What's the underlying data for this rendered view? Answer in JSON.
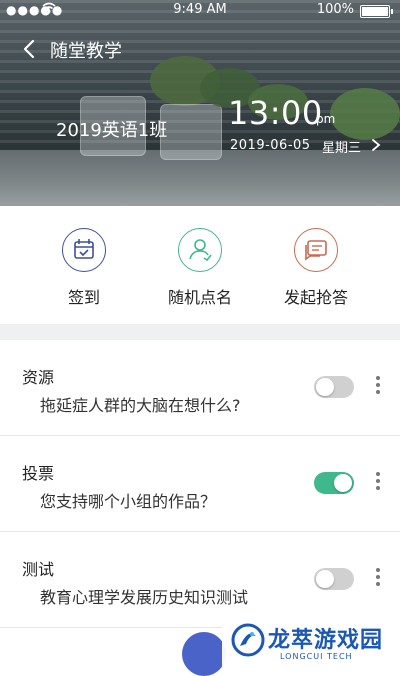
{
  "status": {
    "signal": "●●●●●",
    "time": "9:49 AM",
    "battery": "100%"
  },
  "nav": {
    "title": "随堂教学"
  },
  "hero": {
    "class_name": "2019英语1班",
    "clock": "13:00",
    "ampm": "pm",
    "date": "2019-06-05",
    "weekday": "星期三"
  },
  "actions": [
    {
      "label": "签到",
      "color": "#3e4fa0"
    },
    {
      "label": "随机点名",
      "color": "#3fb88e"
    },
    {
      "label": "发起抢答",
      "color": "#c96a50"
    }
  ],
  "items": [
    {
      "category": "资源",
      "text": "拖延症人群的大脑在想什么?",
      "enabled": false
    },
    {
      "category": "投票",
      "text": "您支持哪个小组的作品？",
      "enabled": true
    },
    {
      "category": "测试",
      "text": "教育心理学发展历史知识测试",
      "enabled": false
    }
  ],
  "watermark": {
    "text": "龙萃游戏园",
    "sub": "LONGCUI TECH"
  },
  "colors": {
    "toggle_on": "#3fb88e",
    "fab": "#4a63c9"
  }
}
